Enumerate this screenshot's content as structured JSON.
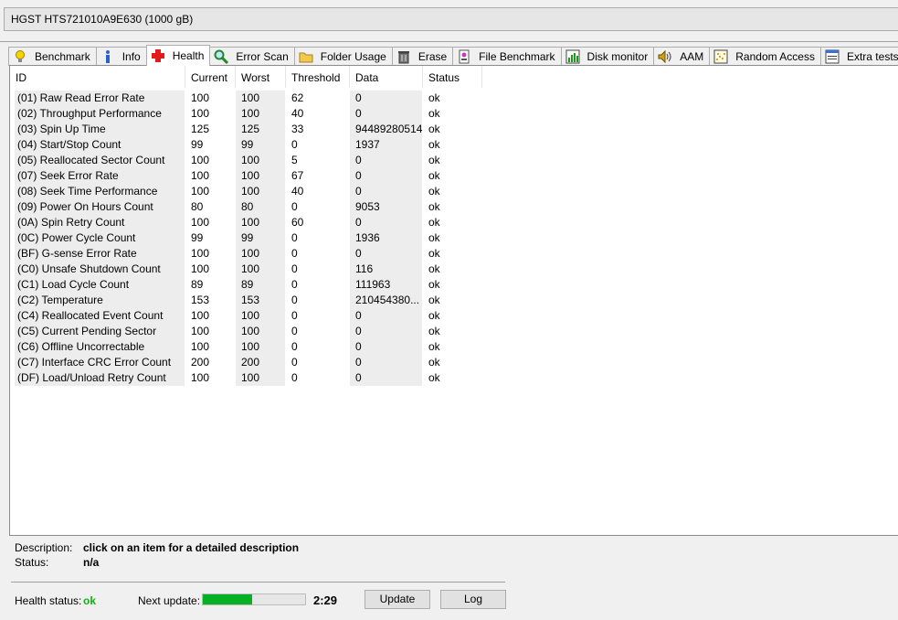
{
  "drive": {
    "label": "HGST HTS721010A9E630 (1000 gB)"
  },
  "tabs": [
    {
      "label": "Benchmark",
      "icon": "bulb-icon"
    },
    {
      "label": "Info",
      "icon": "info-icon"
    },
    {
      "label": "Health",
      "icon": "health-cross-icon",
      "active": true
    },
    {
      "label": "Error Scan",
      "icon": "magnifier-icon"
    },
    {
      "label": "Folder Usage",
      "icon": "folder-icon"
    },
    {
      "label": "Erase",
      "icon": "trash-icon"
    },
    {
      "label": "File Benchmark",
      "icon": "file-benchmark-icon"
    },
    {
      "label": "Disk monitor",
      "icon": "disk-monitor-icon"
    },
    {
      "label": "AAM",
      "icon": "speaker-icon"
    },
    {
      "label": "Random Access",
      "icon": "random-access-icon"
    },
    {
      "label": "Extra tests",
      "icon": "extra-tests-icon"
    }
  ],
  "table": {
    "headers": [
      "ID",
      "Current",
      "Worst",
      "Threshold",
      "Data",
      "Status"
    ],
    "rows": [
      [
        "(01) Raw Read Error Rate",
        "100",
        "100",
        "62",
        "0",
        "ok"
      ],
      [
        "(02) Throughput Performance",
        "100",
        "100",
        "40",
        "0",
        "ok"
      ],
      [
        "(03) Spin Up Time",
        "125",
        "125",
        "33",
        "94489280514",
        "ok"
      ],
      [
        "(04) Start/Stop Count",
        "99",
        "99",
        "0",
        "1937",
        "ok"
      ],
      [
        "(05) Reallocated Sector Count",
        "100",
        "100",
        "5",
        "0",
        "ok"
      ],
      [
        "(07) Seek Error Rate",
        "100",
        "100",
        "67",
        "0",
        "ok"
      ],
      [
        "(08) Seek Time Performance",
        "100",
        "100",
        "40",
        "0",
        "ok"
      ],
      [
        "(09) Power On Hours Count",
        "80",
        "80",
        "0",
        "9053",
        "ok"
      ],
      [
        "(0A) Spin Retry Count",
        "100",
        "100",
        "60",
        "0",
        "ok"
      ],
      [
        "(0C) Power Cycle Count",
        "99",
        "99",
        "0",
        "1936",
        "ok"
      ],
      [
        "(BF) G-sense Error Rate",
        "100",
        "100",
        "0",
        "0",
        "ok"
      ],
      [
        "(C0) Unsafe Shutdown Count",
        "100",
        "100",
        "0",
        "116",
        "ok"
      ],
      [
        "(C1) Load Cycle Count",
        "89",
        "89",
        "0",
        "111963",
        "ok"
      ],
      [
        "(C2) Temperature",
        "153",
        "153",
        "0",
        "210454380...",
        "ok"
      ],
      [
        "(C4) Reallocated Event Count",
        "100",
        "100",
        "0",
        "0",
        "ok"
      ],
      [
        "(C5) Current Pending Sector",
        "100",
        "100",
        "0",
        "0",
        "ok"
      ],
      [
        "(C6) Offline Uncorrectable",
        "100",
        "100",
        "0",
        "0",
        "ok"
      ],
      [
        "(C7) Interface CRC Error Count",
        "200",
        "200",
        "0",
        "0",
        "ok"
      ],
      [
        "(DF) Load/Unload Retry Count",
        "100",
        "100",
        "0",
        "0",
        "ok"
      ]
    ]
  },
  "description": {
    "label": "Description:",
    "value": "click on an item for a detailed description"
  },
  "status": {
    "label": "Status:",
    "value": "n/a"
  },
  "health": {
    "label": "Health status:",
    "value": "ok",
    "value_color": "#12b012"
  },
  "next_update": {
    "label": "Next update:",
    "progress": 0.48,
    "time": "2:29"
  },
  "buttons": {
    "update": "Update",
    "log": "Log"
  }
}
